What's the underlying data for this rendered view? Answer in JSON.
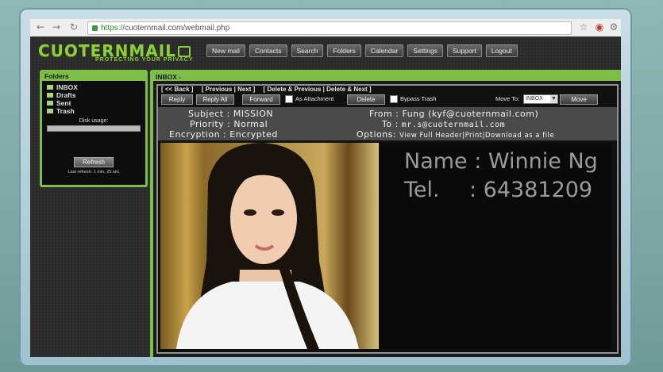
{
  "browser": {
    "back_icon": "back-arrow-icon",
    "forward_icon": "forward-arrow-icon",
    "reload_icon": "reload-icon",
    "url_protocol": "https://",
    "url_rest": "cuoternmail.com/webmail.php",
    "star_icon": "star-icon",
    "extension_icon": "extension-icon",
    "wrench_icon": "wrench-icon"
  },
  "logo": {
    "wordmark": "CUOTERNMAIL",
    "tagline": "PROTECTING YOUR PRIVACY"
  },
  "menu": [
    "New mail",
    "Contacts",
    "Search",
    "Folders",
    "Calendar",
    "Settings",
    "Support",
    "Logout"
  ],
  "folders": {
    "title": "Folders",
    "items": [
      "INBOX",
      "Drafts",
      "Sent",
      "Trash"
    ],
    "disk_usage_label": "Disk usage:",
    "refresh_label": "Refresh",
    "last_refresh": "Last refresh: 1 min, 25 sec"
  },
  "inbox": {
    "title": "INBOX -",
    "nav": [
      "[ << Back ]",
      "[ Previous | Next ]",
      "[ Delete & Previous | Delete & Next ]"
    ],
    "actions": {
      "reply": "Reply",
      "reply_all": "Reply All",
      "forward": "Forward",
      "as_attachment": "As Attachment",
      "delete": "Delete",
      "bypass_trash": "Bypass Trash",
      "move_to_label": "Move To:",
      "move_to_value": "INBOX",
      "move": "Move"
    },
    "message": {
      "subject_label": "Subject :",
      "subject": "MISSION",
      "priority_label": "Priority :",
      "priority": "Normal",
      "encryption_label": "Encryption :",
      "encryption": "Encrypted",
      "from_label": "From :",
      "from": "Fung (kyf@cuoternmail.com)",
      "to_label": "To :",
      "to": "mr.s@cuoternmail.com",
      "options_label": "Options:",
      "options": "View Full Header|Print|Download as a file"
    },
    "attachment": {
      "name_line": "Name : Winnie Ng",
      "tel_label": "Tel.",
      "tel_value": ": 64381209"
    }
  },
  "colors": {
    "accent": "#7cbe46",
    "background": "#2b2b2b"
  }
}
